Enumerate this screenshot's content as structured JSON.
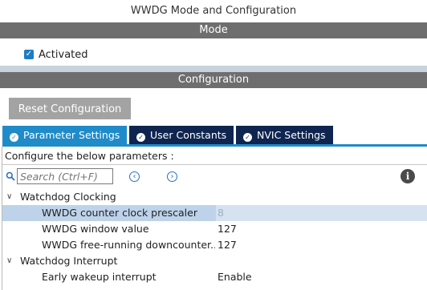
{
  "window": {
    "title": "WWDG Mode and Configuration"
  },
  "mode": {
    "header": "Mode",
    "activated_label": "Activated",
    "activated_checked": true
  },
  "configuration": {
    "header": "Configuration",
    "reset_button": "Reset Configuration",
    "tabs": [
      {
        "label": "Parameter Settings",
        "active": true
      },
      {
        "label": "User Constants",
        "active": false
      },
      {
        "label": "NVIC Settings",
        "active": false
      }
    ],
    "instructions": "Configure the below parameters :",
    "search": {
      "placeholder": "Search (Ctrl+F)"
    },
    "tree": [
      {
        "group": "Watchdog Clocking",
        "params": [
          {
            "name": "WWDG counter clock prescaler",
            "value": "8",
            "selected": true
          },
          {
            "name": "WWDG window value",
            "value": "127"
          },
          {
            "name": "WWDG free-running downcounter...",
            "value": "127"
          }
        ]
      },
      {
        "group": "Watchdog Interrupt",
        "params": [
          {
            "name": "Early wakeup interrupt",
            "value": "Enable"
          }
        ]
      }
    ]
  },
  "colors": {
    "active_tab": "#1f8bc8",
    "inactive_tab": "#0f2550",
    "section_bar": "#6e6e6e",
    "selection": "#bed3ea"
  },
  "icons": {
    "tab_status": "check-circle-icon",
    "search": "search-icon",
    "prev": "chevron-left-icon",
    "next": "chevron-right-icon",
    "info": "info-icon"
  }
}
